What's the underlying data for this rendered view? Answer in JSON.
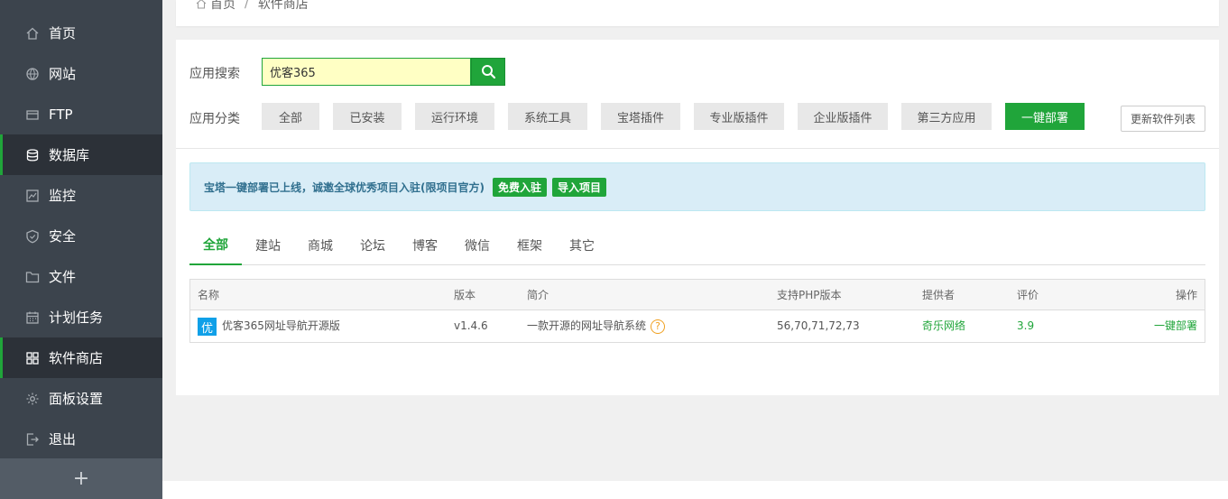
{
  "sidebar": {
    "items": [
      {
        "label": "首页",
        "icon": "home-icon"
      },
      {
        "label": "网站",
        "icon": "globe-icon"
      },
      {
        "label": "FTP",
        "icon": "ftp-icon"
      },
      {
        "label": "数据库",
        "icon": "database-icon"
      },
      {
        "label": "监控",
        "icon": "monitor-icon"
      },
      {
        "label": "安全",
        "icon": "shield-icon"
      },
      {
        "label": "文件",
        "icon": "folder-icon"
      },
      {
        "label": "计划任务",
        "icon": "calendar-icon"
      },
      {
        "label": "软件商店",
        "icon": "grid-icon"
      },
      {
        "label": "面板设置",
        "icon": "gear-icon"
      },
      {
        "label": "退出",
        "icon": "logout-icon"
      }
    ],
    "add_label": "+"
  },
  "breadcrumb": {
    "home": "首页",
    "separator": "/",
    "current": "软件商店"
  },
  "search": {
    "label": "应用搜索",
    "value": "优客365"
  },
  "categories": {
    "label": "应用分类",
    "items": [
      "全部",
      "已安装",
      "运行环境",
      "系统工具",
      "宝塔插件",
      "专业版插件",
      "企业版插件",
      "第三方应用",
      "一键部署"
    ],
    "update_button": "更新软件列表"
  },
  "notice": {
    "text": "宝塔一键部署已上线，诚邀全球优秀项目入驻(限项目官方)",
    "btn_join": "免费入驻",
    "btn_import": "导入项目"
  },
  "tabs": [
    "全部",
    "建站",
    "商城",
    "论坛",
    "博客",
    "微信",
    "框架",
    "其它"
  ],
  "table": {
    "headers": {
      "name": "名称",
      "version": "版本",
      "desc": "简介",
      "php": "支持PHP版本",
      "provider": "提供者",
      "rating": "评价",
      "action": "操作"
    },
    "rows": [
      {
        "icon_char": "优",
        "name": "优客365网址导航开源版",
        "version": "v1.4.6",
        "desc": "一款开源的网址导航系统",
        "help": "?",
        "php": "56,70,71,72,73",
        "provider": "奇乐网络",
        "rating": "3.9",
        "action": "一键部署"
      }
    ]
  },
  "colors": {
    "accent": "#20a53a",
    "sidebar": "#3c444d",
    "notice_bg": "#d9edf7",
    "search_bg": "#ffffc4"
  }
}
